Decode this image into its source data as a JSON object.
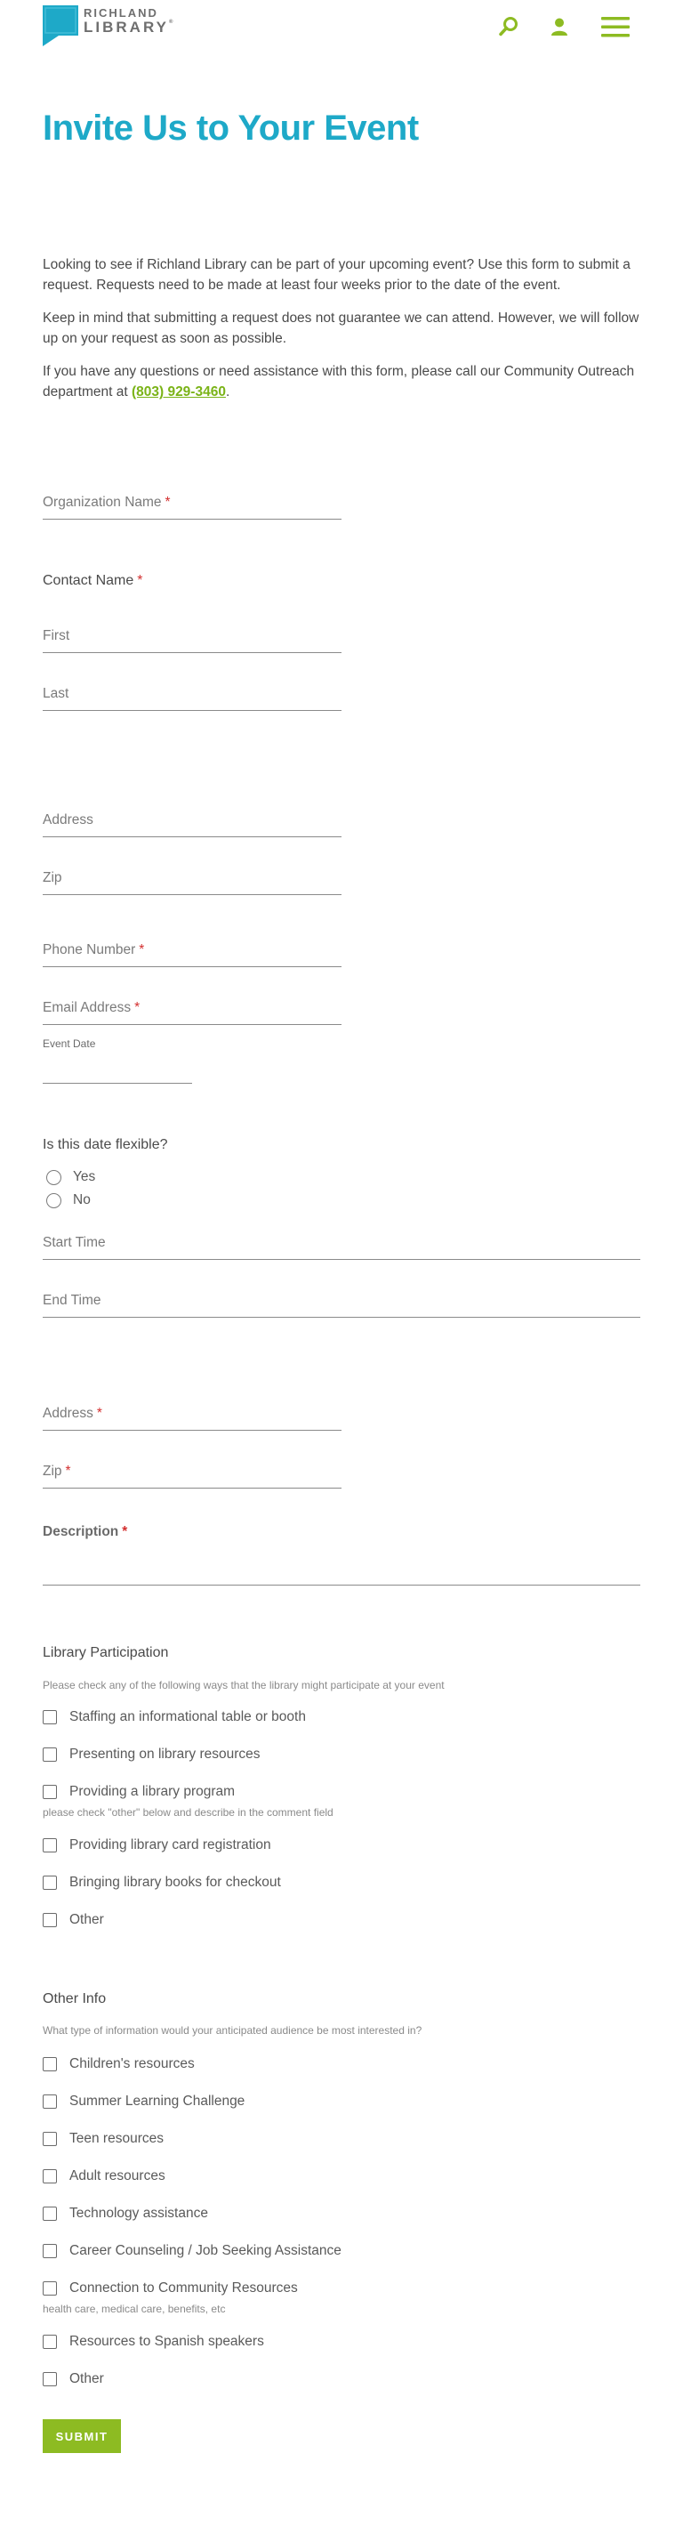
{
  "header": {
    "logo_line1": "RICHLAND",
    "logo_line2": "LIBRARY",
    "logo_mark": "®",
    "icons": {
      "search": "search-icon",
      "account": "user-icon",
      "menu": "hamburger-menu-icon"
    },
    "brand_color": "#1ea9c8",
    "accent_color": "#8dbb22"
  },
  "page": {
    "title": "Invite Us to Your Event",
    "intro_p1": "Looking to see if Richland Library can be part of your upcoming event? Use this form to submit a request. Requests need to be made at least four weeks prior to the date of the event.",
    "intro_p2": "Keep in mind that submitting a request does not guarantee we can attend. However, we will follow up on your request as soon as possible.",
    "intro_p3_pre": "If you have any questions or need assistance with this form, please call our Community Outreach department at ",
    "intro_phone": "(803) 929-3460",
    "intro_p3_post": "."
  },
  "form": {
    "required_mark": "*",
    "organization_name": "Organization Name",
    "contact_name": "Contact Name",
    "first": "First",
    "last": "Last",
    "address": "Address",
    "zip": "Zip",
    "phone": "Phone Number",
    "email": "Email Address",
    "event_date": "Event Date",
    "date_flexible_q": "Is this date flexible?",
    "yes": "Yes",
    "no": "No",
    "start_time": "Start Time",
    "end_time": "End Time",
    "event_address": "Address",
    "event_zip": "Zip",
    "description": "Description",
    "participation": {
      "heading": "Library Participation",
      "hint": "Please check any of the following ways that the library might participate at your event",
      "options": [
        "Staffing an informational table or booth",
        "Presenting on library resources",
        "Providing a library program",
        "Providing library card registration",
        "Bringing library books for checkout",
        "Other"
      ],
      "program_hint": "please check \"other\" below and describe in the comment field"
    },
    "other_info": {
      "heading": "Other Info",
      "hint": "What type of information would your anticipated audience be most interested in?",
      "options": [
        "Children's resources",
        "Summer Learning Challenge",
        "Teen resources",
        "Adult resources",
        "Technology assistance",
        "Career Counseling / Job Seeking Assistance",
        "Connection to Community Resources",
        "Resources to Spanish speakers",
        "Other"
      ],
      "community_hint": "health care, medical care, benefits, etc"
    },
    "submit": "SUBMIT"
  }
}
